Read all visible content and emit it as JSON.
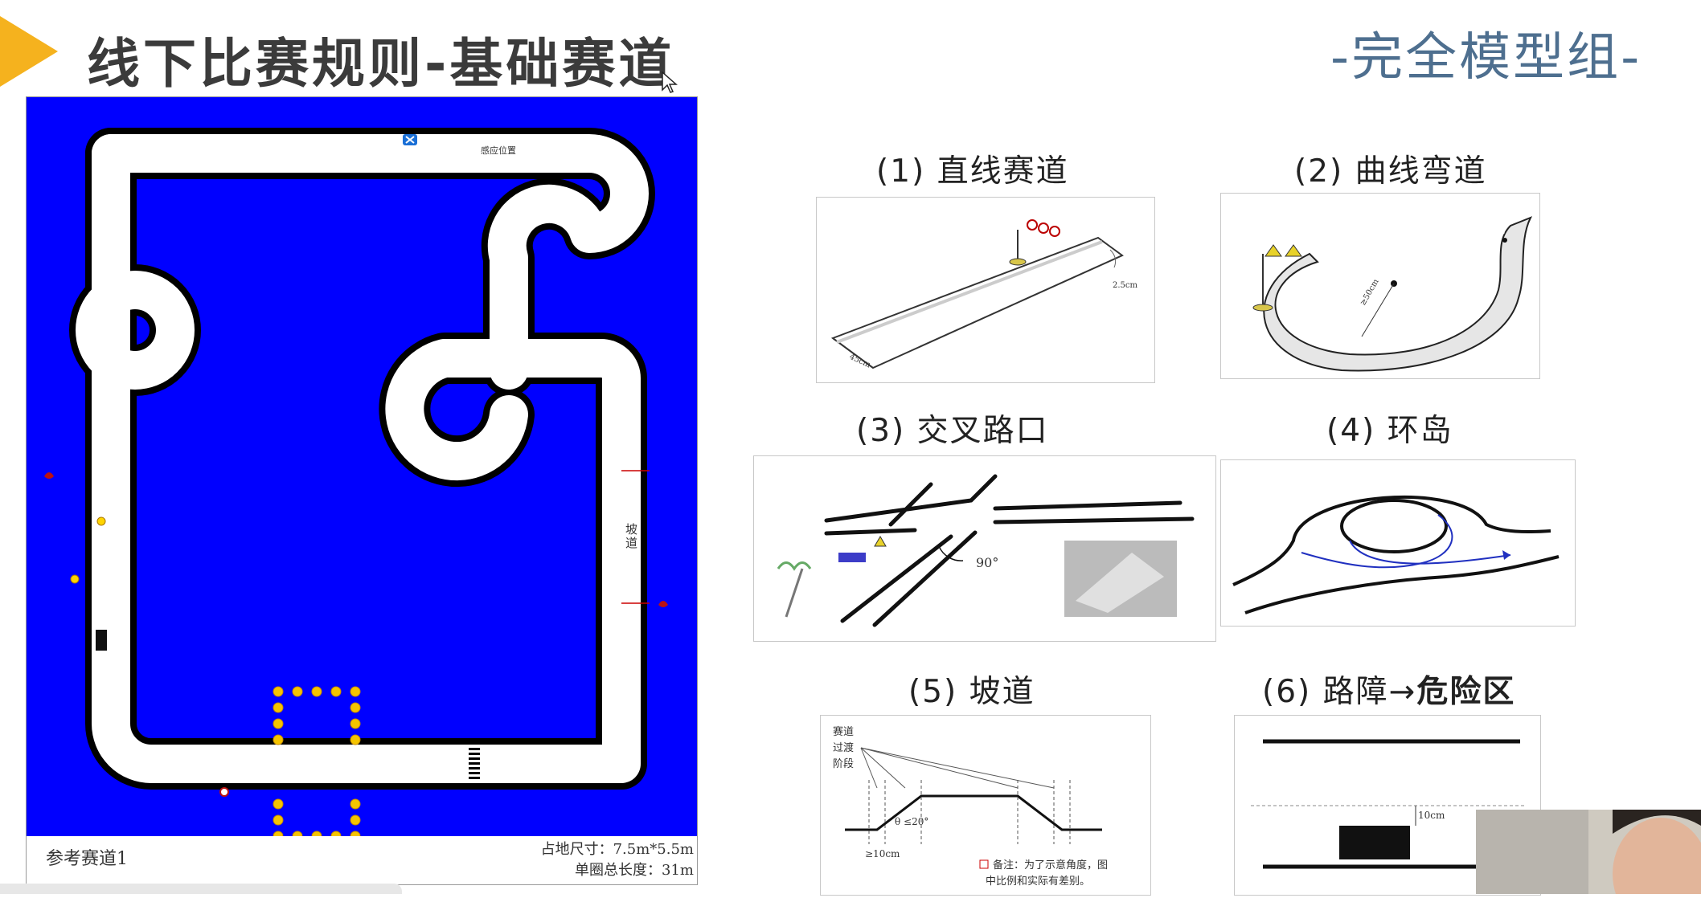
{
  "header": {
    "title": "线下比赛规则-基础赛道",
    "group": "-完全模型组-",
    "accent_color": "#f5b21e"
  },
  "track_map": {
    "background_color": "#0000ff",
    "name": "参考赛道1",
    "size": "占地尺寸：7.5m*5.5m",
    "length": "单圈总长度：31m",
    "sense_position_label": "感应位置",
    "ramp_label": "坡道"
  },
  "sections": [
    {
      "label": "(1) 直线赛道",
      "measure_width": "45cm",
      "measure_edge": "2.5cm"
    },
    {
      "label": "(2) 曲线弯道",
      "measure_radius": "≥50cm"
    },
    {
      "label": "(3) 交叉路口",
      "angle": "90°"
    },
    {
      "label": "(4) 环岛"
    },
    {
      "label": "(5) 坡道",
      "diagram_text_1": "赛道",
      "diagram_text_2": "过渡",
      "diagram_text_3": "阶段",
      "angle_text": "θ ≤20°",
      "length_text": "≥10cm",
      "note_line1": "备注：为了示意角度，图",
      "note_line2": "中比例和实际有差别。"
    },
    {
      "label_prefix": "(6) 路障→",
      "label_bold": "危险区",
      "gap_text": "10cm"
    }
  ]
}
